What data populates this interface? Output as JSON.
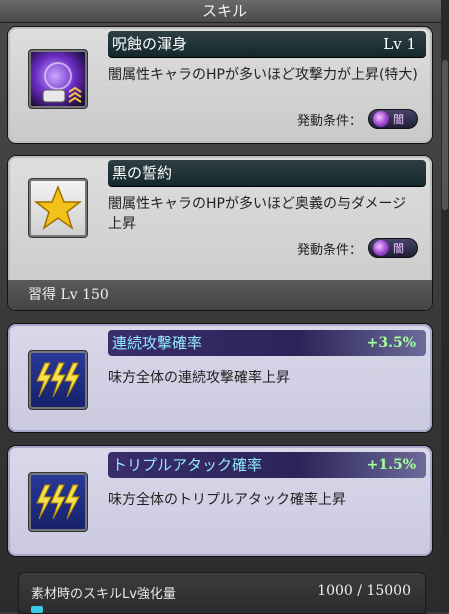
{
  "header": {
    "title": "スキル"
  },
  "skills": [
    {
      "name": "呪蝕の渾身",
      "level": "Lv 1",
      "description": "闇属性キャラのHPが多いほど攻撃力が上昇(特大)",
      "condition_label": "発動条件：",
      "condition_element": "闇",
      "icon": "dark-orb-arm-icon"
    },
    {
      "name": "黒の誓約",
      "description": "闇属性キャラのHPが多いほど奥義の与ダメージ上昇",
      "condition_label": "発動条件：",
      "condition_element": "闇",
      "learn_label": "習得",
      "learn_level": "Lv 150",
      "icon": "gold-star-icon"
    }
  ],
  "bonuses": [
    {
      "name": "連続攻撃確率",
      "value": "+3.5%",
      "description": "味方全体の連続攻撃確率上昇",
      "icon": "triple-lightning-icon"
    },
    {
      "name": "トリプルアタック確率",
      "value": "+1.5%",
      "description": "味方全体のトリプルアタック確率上昇",
      "icon": "triple-lightning-icon"
    }
  ],
  "footer": {
    "label": "素材時のスキルLv強化量",
    "value": "1000 / 15000",
    "progress_fraction": 0.067
  },
  "colors": {
    "bonus_title": "#8fe9ff",
    "bonus_value": "#a6ff9a",
    "progress": "#38cbe6"
  }
}
